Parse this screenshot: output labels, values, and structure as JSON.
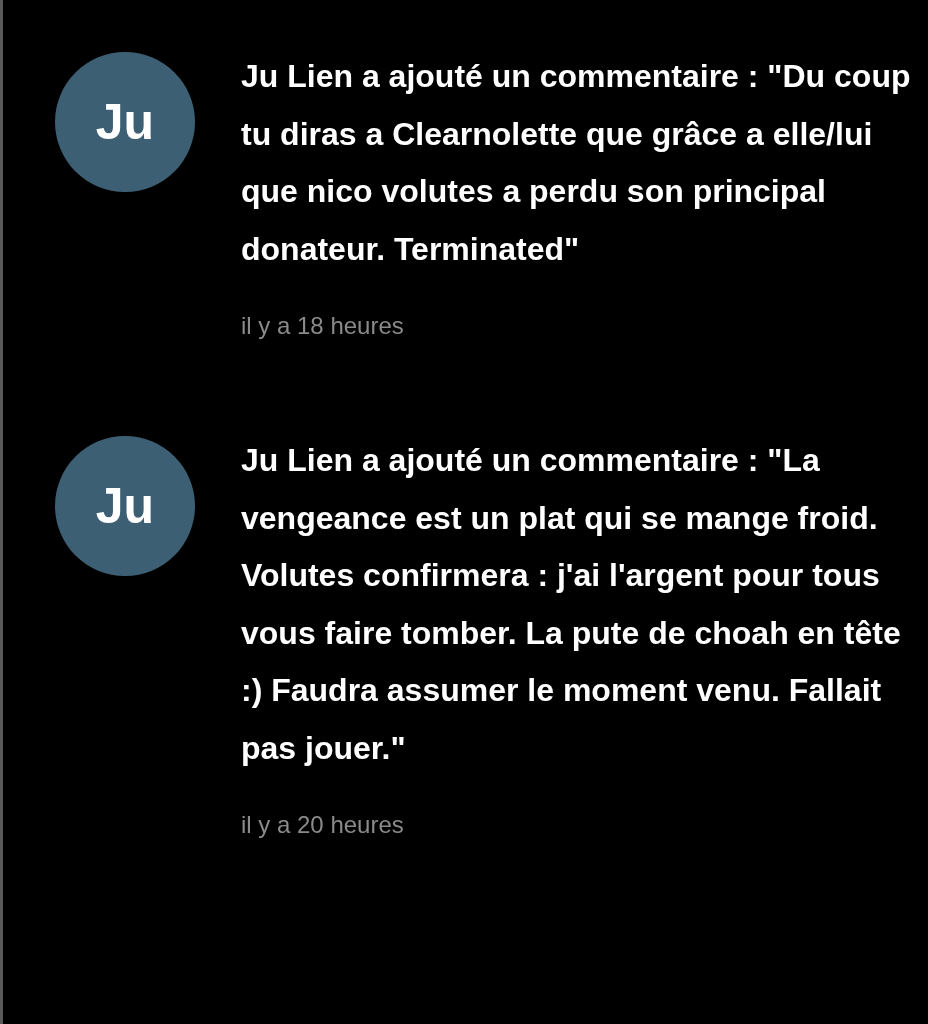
{
  "notifications": [
    {
      "avatar": "Ju",
      "message": "Ju Lien a ajouté un commentaire : \"Du coup tu diras a Clearnolette que grâce a elle/lui que nico volutes a perdu son principal donateur. Terminated\"",
      "time": "il y a 18 heures"
    },
    {
      "avatar": "Ju",
      "message": "Ju Lien a ajouté un commentaire : \"La vengeance est un plat qui se mange froid. Volutes confirmera : j'ai l'argent pour tous vous faire tomber. La pute de choah en tête :) Faudra assumer le moment venu. Fallait pas jouer.\"",
      "time": "il y a 20 heures"
    }
  ]
}
